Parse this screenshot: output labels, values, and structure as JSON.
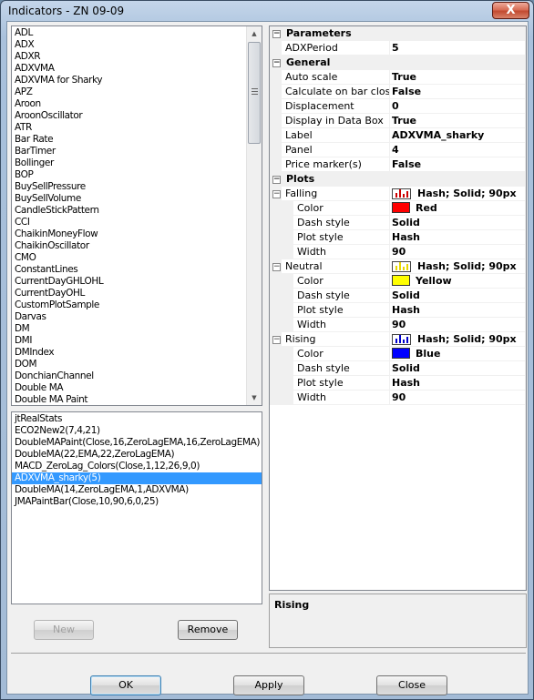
{
  "window": {
    "title": "Indicators - ZN 09-09",
    "close_glyph": "X"
  },
  "available": [
    "ADL",
    "ADX",
    "ADXR",
    "ADXVMA",
    "ADXVMA for Sharky",
    "APZ",
    "Aroon",
    "AroonOscillator",
    "ATR",
    "Bar Rate",
    "BarTimer",
    "Bollinger",
    "BOP",
    "BuySellPressure",
    "BuySellVolume",
    "CandleStickPattern",
    "CCI",
    "ChaikinMoneyFlow",
    "ChaikinOscillator",
    "CMO",
    "ConstantLines",
    "CurrentDayGHLOHL",
    "CurrentDayOHL",
    "CustomPlotSample",
    "Darvas",
    "DM",
    "DMI",
    "DMIndex",
    "DOM",
    "DonchianChannel",
    "Double MA",
    "Double MA Paint"
  ],
  "applied": [
    "jtRealStats",
    "ECO2New2(7,4,21)",
    "DoubleMAPaint(Close,16,ZeroLagEMA,16,ZeroLagEMA)",
    "DoubleMA(22,EMA,22,ZeroLagEMA)",
    "MACD_ZeroLag_Colors(Close,1,12,26,9,0)",
    "ADXVMA_sharky(5)",
    "DoubleMA(14,ZeroLagEMA,1,ADXVMA)",
    "JMAPaintBar(Close,10,90,6,0,25)"
  ],
  "applied_selected": "ADXVMA_sharky(5)",
  "buttons": {
    "new": "New",
    "remove": "Remove",
    "ok": "OK",
    "apply": "Apply",
    "close": "Close"
  },
  "props": {
    "parameters": {
      "label": "Parameters",
      "rows": [
        {
          "name": "ADXPeriod",
          "value": "5"
        }
      ]
    },
    "general": {
      "label": "General",
      "rows": [
        {
          "name": "Auto scale",
          "value": "True"
        },
        {
          "name": "Calculate on bar close",
          "value": "False"
        },
        {
          "name": "Displacement",
          "value": "0"
        },
        {
          "name": "Display in Data Box",
          "value": "True"
        },
        {
          "name": "Label",
          "value": "ADXVMA_sharky"
        },
        {
          "name": "Panel",
          "value": "4"
        },
        {
          "name": "Price marker(s)",
          "value": "False"
        }
      ]
    },
    "plots": {
      "label": "Plots",
      "items": [
        {
          "name": "Falling",
          "summary": "Hash; Solid; 90px",
          "icon_color": "#cc0000",
          "color_label": "Color",
          "color_name": "Red",
          "color_hex": "#ff0000",
          "dash_label": "Dash style",
          "dash": "Solid",
          "plot_label": "Plot style",
          "plot": "Hash",
          "width_label": "Width",
          "width": "90"
        },
        {
          "name": "Neutral",
          "summary": "Hash; Solid; 90px",
          "icon_color": "#e8d800",
          "color_label": "Color",
          "color_name": "Yellow",
          "color_hex": "#ffff00",
          "dash_label": "Dash style",
          "dash": "Solid",
          "plot_label": "Plot style",
          "plot": "Hash",
          "width_label": "Width",
          "width": "90"
        },
        {
          "name": "Rising",
          "summary": "Hash; Solid; 90px",
          "icon_color": "#0000cc",
          "color_label": "Color",
          "color_name": "Blue",
          "color_hex": "#0000ff",
          "dash_label": "Dash style",
          "dash": "Solid",
          "plot_label": "Plot style",
          "plot": "Hash",
          "width_label": "Width",
          "width": "90"
        }
      ]
    }
  },
  "description": {
    "title": "Rising"
  },
  "icons": {
    "expand": "minus-box-icon",
    "scroll_up": "scroll-up-arrow-icon",
    "scroll_down": "scroll-down-arrow-icon"
  }
}
